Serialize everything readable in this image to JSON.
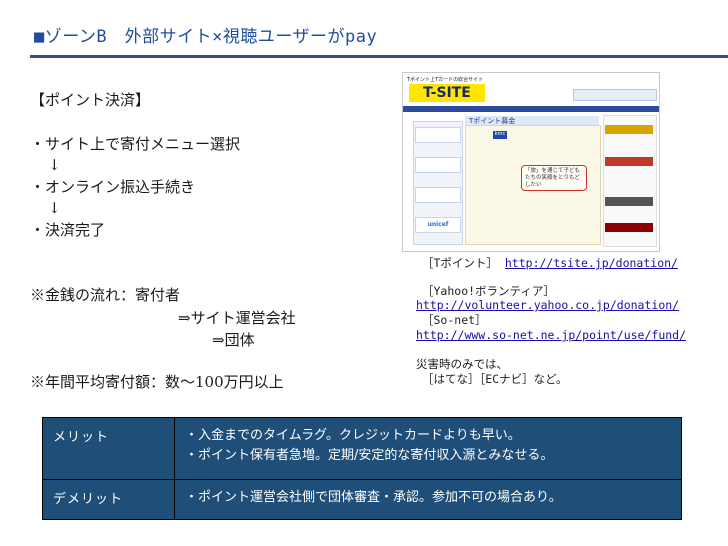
{
  "header": {
    "title": "■ゾーンB　外部サイト×視聴ユーザーがpay"
  },
  "left": {
    "section_title": "【ポイント決済】",
    "steps": [
      "・サイト上で寄付メニュー選択",
      "↓",
      "・オンライン振込手続き",
      "↓",
      "・決済完了"
    ],
    "money_flow": [
      "※金銭の流れ：寄付者",
      "⇒サイト運営会社",
      "⇒団体"
    ],
    "annual_avg": "※年間平均寄付額：数〜100万円以上"
  },
  "screenshot": {
    "header_text": "Tポイント上Tカードの総合サイト",
    "logo": "T-SITE",
    "main_title": "Tポイント募金",
    "badge": "kmc",
    "bubble_text": "「旅」を通じて子どもたちの笑顔をとりもどしたい",
    "left_buttons": [
      "",
      "",
      "",
      "unicef"
    ],
    "right_blocks": [
      "",
      "",
      "",
      ""
    ]
  },
  "references": {
    "tpoint_label": "［Tポイント］",
    "tpoint_url": "http://tsite.jp/donation/",
    "yahoo_label": "［Yahoo!ボランティア］",
    "yahoo_url": "http://volunteer.yahoo.co.jp/donation/",
    "sonet_label": "［So-net］",
    "sonet_url": "http://www.so-net.ne.jp/point/use/fund/",
    "disaster_note": "災害時のみでは、",
    "others": "［はてな］［ECナビ］など。"
  },
  "table": {
    "rows": [
      {
        "label": "メリット",
        "lines": [
          "・入金までのタイムラグ。クレジットカードよりも早い。",
          "・ポイント保有者急増。定期/安定的な寄付収入源とみなせる。"
        ]
      },
      {
        "label": "デメリット",
        "lines": [
          "・ポイント運営会社側で団体審査・承認。参加不可の場合あり。"
        ]
      }
    ]
  }
}
